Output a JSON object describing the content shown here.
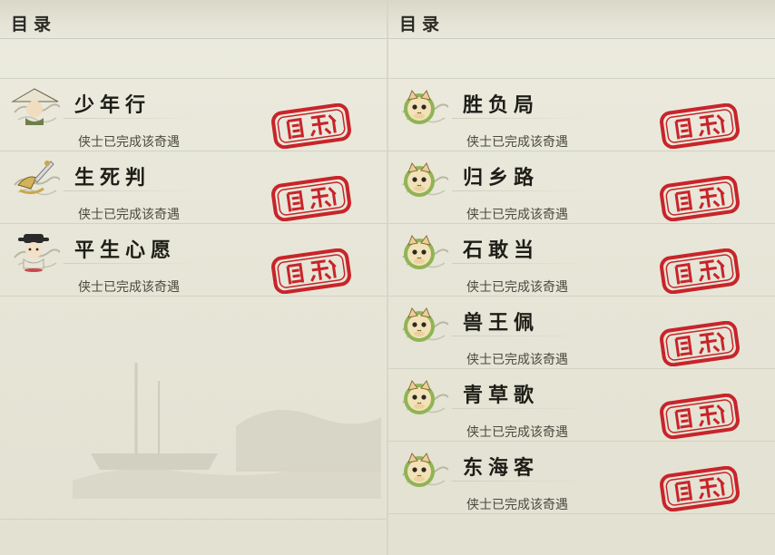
{
  "left_panel": {
    "title": "目录",
    "entries": [
      {
        "name": "少年行",
        "status": "侠士已完成该奇遇",
        "icon": "scholar-hat-icon",
        "stamp": "completed-stamp"
      },
      {
        "name": "生死判",
        "status": "侠士已完成该奇遇",
        "icon": "gold-sword-icon",
        "stamp": "completed-stamp"
      },
      {
        "name": "平生心愿",
        "status": "侠士已完成该奇遇",
        "icon": "official-figure-icon",
        "stamp": "completed-stamp"
      }
    ]
  },
  "right_panel": {
    "title": "目录",
    "entries": [
      {
        "name": "胜负局",
        "status": "侠士已完成该奇遇",
        "icon": "cat-icon",
        "stamp": "completed-stamp"
      },
      {
        "name": "归乡路",
        "status": "侠士已完成该奇遇",
        "icon": "cat-icon",
        "stamp": "completed-stamp"
      },
      {
        "name": "石敢当",
        "status": "侠士已完成该奇遇",
        "icon": "cat-icon",
        "stamp": "completed-stamp"
      },
      {
        "name": "兽王佩",
        "status": "侠士已完成该奇遇",
        "icon": "cat-icon",
        "stamp": "completed-stamp"
      },
      {
        "name": "青草歌",
        "status": "侠士已完成该奇遇",
        "icon": "cat-icon",
        "stamp": "completed-stamp"
      },
      {
        "name": "东海客",
        "status": "侠士已完成该奇遇",
        "icon": "cat-icon",
        "stamp": "completed-stamp"
      }
    ]
  },
  "colors": {
    "stamp_red": "#c8242a",
    "accent_green": "#7fa84a"
  }
}
